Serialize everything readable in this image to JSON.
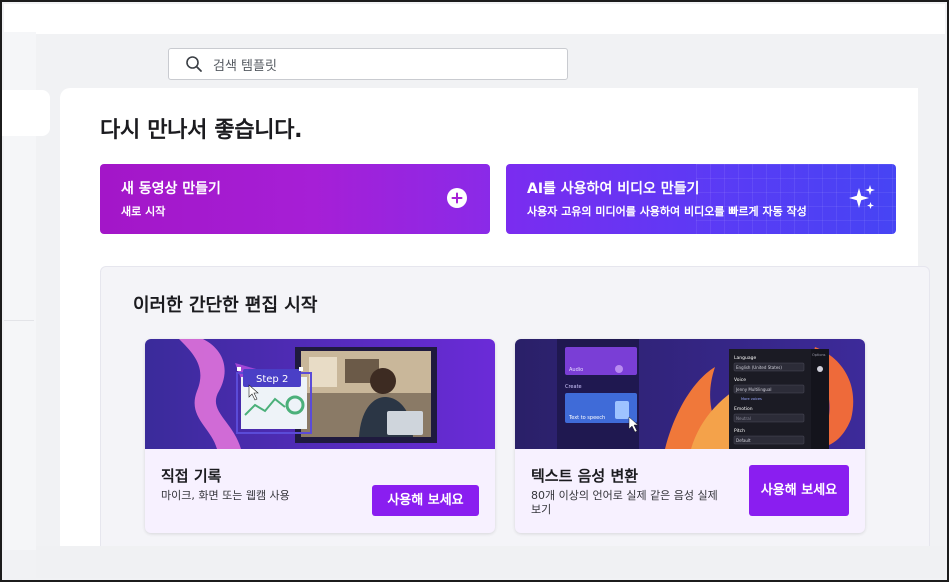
{
  "search": {
    "placeholder": "검색 템플릿"
  },
  "greeting": "다시 만나서 좋습니다.",
  "actions": {
    "new_video": {
      "title": "새 동영상 만들기",
      "subtitle": "새로 시작",
      "icon": "plus-circle-icon"
    },
    "ai_video": {
      "title": "AI를 사용하여 비디오 만들기",
      "subtitle": "사용자 고유의 미디어를 사용하여 비디오를 빠르게 자동 작성",
      "icon": "sparkle-icon"
    }
  },
  "quick_edits": {
    "title": "이러한 간단한 편집 시작",
    "cards": [
      {
        "title": "직접 기록",
        "description": "마이크, 화면 또는 웹캠 사용",
        "button": "사용해 보세요",
        "thumbnail": {
          "step_label": "Step 2"
        }
      },
      {
        "title": "텍스트 음성 변환",
        "description": "80개 이상의 언어로 실제 같은 음성 실제 보기",
        "button": "사용해 보세요",
        "thumbnail": {
          "audio_label": "Audio",
          "create_label": "Create",
          "tts_label": "Text to speech",
          "language_label": "Language",
          "language_value": "English (United States)",
          "voice_label": "Voice",
          "voice_value": "Jenny Multilingual",
          "more_voices": "More voices",
          "emotion_label": "Emotion",
          "emotion_value": "Neutral",
          "pitch_label": "Pitch",
          "pitch_value": "Default",
          "options_label": "Options"
        }
      }
    ]
  },
  "colors": {
    "accent": "#8a1ef0",
    "cta_new": "#a316c8",
    "cta_ai": "#5a3bf5",
    "card_bg": "#f7f1ff"
  }
}
